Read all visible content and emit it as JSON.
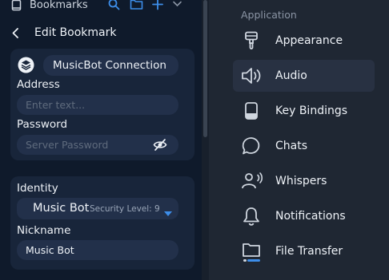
{
  "topbar": {
    "title": "Bookmarks",
    "icons": [
      "bookmark-icon",
      "search-icon",
      "folder-icon",
      "plus-icon",
      "chevron-down-icon"
    ]
  },
  "edit": {
    "title": "Edit Bookmark",
    "server_name": "MusicBot Connection",
    "address": {
      "label": "Address",
      "placeholder": "Enter text..."
    },
    "password": {
      "label": "Password",
      "placeholder": "Server Password"
    },
    "identity": {
      "label": "Identity",
      "name": "Music Bot",
      "security": "Security Level: 9"
    },
    "nickname": {
      "label": "Nickname",
      "value": "Music Bot"
    }
  },
  "settings": {
    "section": "Application",
    "active": "Audio",
    "items": [
      {
        "label": "Appearance",
        "icon": "brush-icon"
      },
      {
        "label": "Audio",
        "icon": "speaker-icon"
      },
      {
        "label": "Key Bindings",
        "icon": "keyboard-icon"
      },
      {
        "label": "Chats",
        "icon": "chat-bubble-icon"
      },
      {
        "label": "Whispers",
        "icon": "whisper-icon"
      },
      {
        "label": "Notifications",
        "icon": "bell-icon"
      },
      {
        "label": "File Transfer",
        "icon": "folder-transfer-icon"
      }
    ]
  },
  "colors": {
    "accent": "#3d8eea",
    "panel": "#0f1a2b",
    "card": "#18253a",
    "field": "#22304a",
    "background": "#1f2733"
  }
}
